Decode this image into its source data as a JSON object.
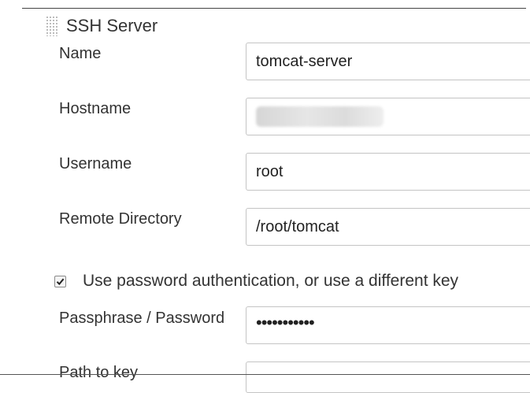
{
  "section": {
    "title": "SSH Server"
  },
  "fields": {
    "name": {
      "label": "Name",
      "value": "tomcat-server"
    },
    "hostname": {
      "label": "Hostname",
      "value": ""
    },
    "username": {
      "label": "Username",
      "value": "root"
    },
    "remote_directory": {
      "label": "Remote Directory",
      "value": "/root/tomcat"
    },
    "passphrase": {
      "label": "Passphrase / Password",
      "value": "•••••••••••"
    },
    "path_to_key": {
      "label": "Path to key",
      "value": ""
    }
  },
  "use_password_auth": {
    "label": "Use password authentication, or use a different key",
    "checked": true
  }
}
